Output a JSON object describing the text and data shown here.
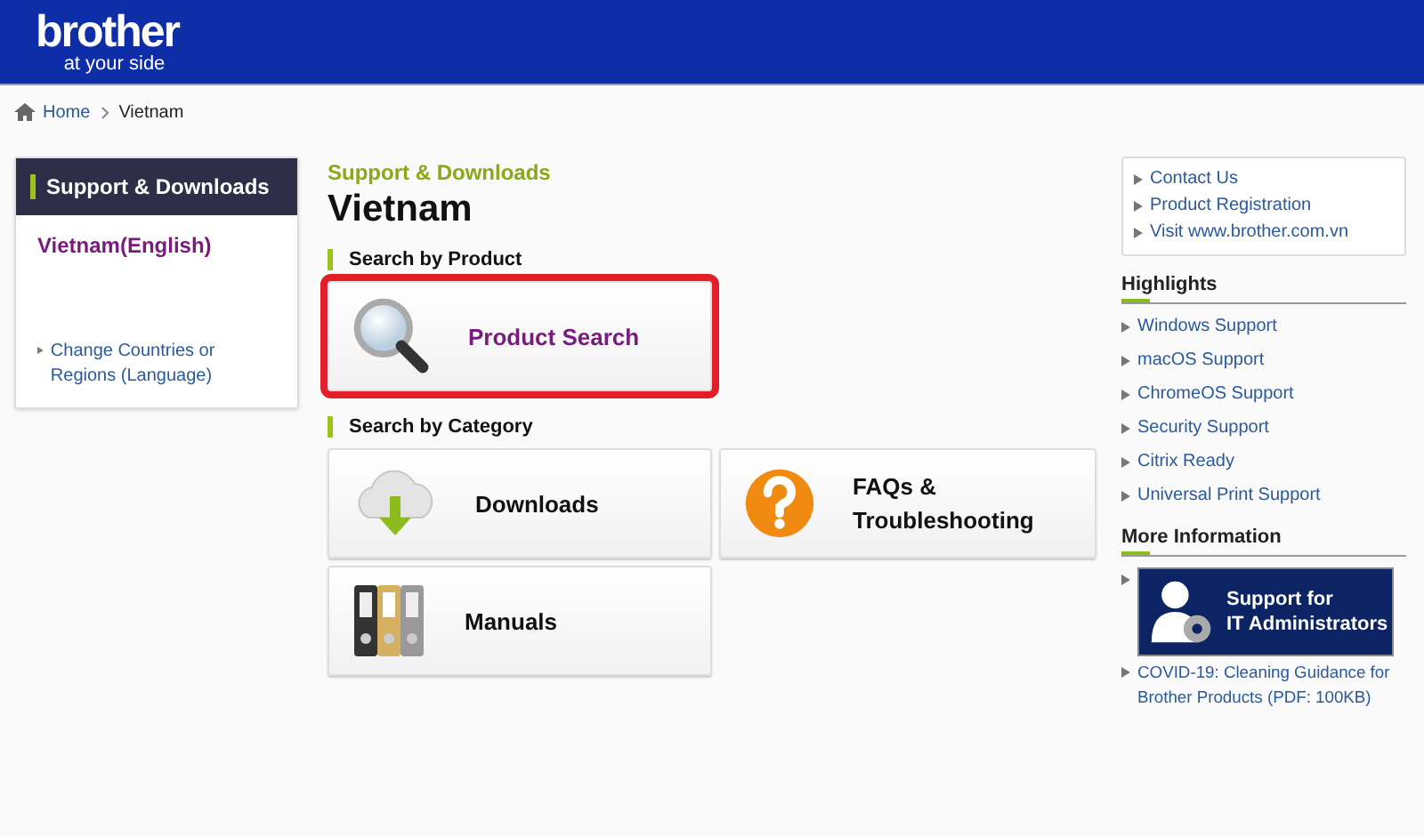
{
  "header": {
    "logo": "brother",
    "tagline": "at your side"
  },
  "breadcrumb": [
    {
      "label": "Home",
      "kind": "home"
    },
    {
      "label": "Vietnam",
      "kind": "current"
    }
  ],
  "sidebar": {
    "title": "Support & Downloads",
    "region": "Vietnam(English)",
    "change_link": "Change Countries or Regions (Language)"
  },
  "main": {
    "eyebrow": "Support & Downloads",
    "title": "Vietnam",
    "product_section": {
      "heading": "Search by Product",
      "tiles": [
        {
          "label": "Product Search",
          "kind": "search",
          "highlighted": true
        }
      ]
    },
    "category_section": {
      "heading": "Search by Category",
      "tiles": [
        {
          "label": "Downloads",
          "kind": "download",
          "highlighted": false
        },
        {
          "label": "FAQs & Troubleshooting",
          "kind": "faq",
          "highlighted": false
        },
        {
          "label": "Manuals",
          "kind": "manuals",
          "highlighted": false
        }
      ]
    }
  },
  "right": {
    "links": [
      "Contact Us",
      "Product Registration",
      "Visit www.brother.com.vn"
    ],
    "highlights": {
      "title": "Highlights",
      "items": [
        "Windows Support",
        "macOS Support",
        "ChromeOS Support",
        "Security Support",
        "Citrix Ready",
        "Universal Print Support"
      ]
    },
    "more_info": {
      "title": "More Information",
      "banner_lines": [
        "Support for",
        "IT Administrators"
      ],
      "links": [
        "COVID-19: Cleaning Guidance for Brother Products (PDF: 100KB)"
      ]
    }
  }
}
